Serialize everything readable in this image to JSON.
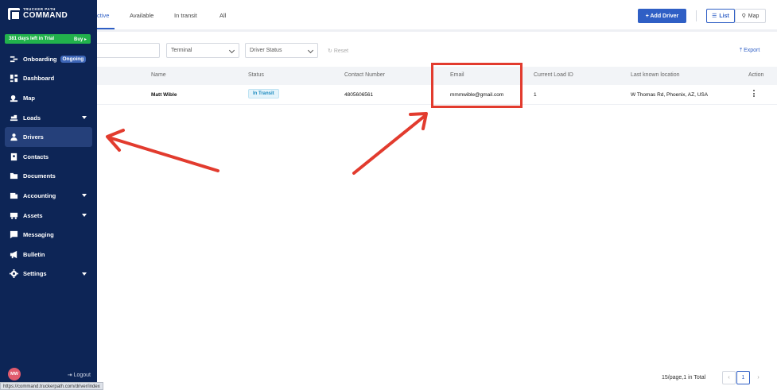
{
  "app": {
    "logo_small": "TRUCKER PATH",
    "logo_big": "COMMAND",
    "trial_text": "381 days left in Trial",
    "trial_buy": "Buy ▸"
  },
  "sidebar": {
    "items": [
      {
        "label": "Onboarding",
        "icon": "onboarding-icon",
        "pill": "Ongoing"
      },
      {
        "label": "Dashboard",
        "icon": "dashboard-icon"
      },
      {
        "label": "Map",
        "icon": "map-icon"
      },
      {
        "label": "Loads",
        "icon": "loads-icon",
        "caret": true
      },
      {
        "label": "Drivers",
        "icon": "driver-icon",
        "active": true
      },
      {
        "label": "Contacts",
        "icon": "contacts-icon"
      },
      {
        "label": "Documents",
        "icon": "folder-icon"
      },
      {
        "label": "Accounting",
        "icon": "accounting-icon",
        "caret": true
      },
      {
        "label": "Assets",
        "icon": "truck-icon",
        "caret": true
      },
      {
        "label": "Messaging",
        "icon": "message-icon"
      },
      {
        "label": "Bulletin",
        "icon": "megaphone-icon"
      },
      {
        "label": "Settings",
        "icon": "gear-icon",
        "caret": true
      }
    ],
    "avatar_initials": "MW",
    "logout_label": "⇥ Logout",
    "status_url": "https://command.truckerpath.com/driver/index"
  },
  "tabs": [
    "ctive",
    "Available",
    "In transit",
    "All"
  ],
  "toolbar": {
    "add_driver": "+ Add Driver",
    "list": "List",
    "map": "Map"
  },
  "filters": {
    "terminal": "Terminal",
    "driver_status": "Driver Status",
    "reset": "Reset",
    "export": "Export"
  },
  "table": {
    "headers": [
      "Name",
      "Status",
      "Contact Number",
      "Email",
      "Current Load ID",
      "Last known location",
      "Action"
    ],
    "rows": [
      {
        "name": "Matt Wible",
        "status": "In Transit",
        "phone": "4805606561",
        "email": "mmmwible@gmail.com",
        "load_id": "1",
        "location": "W Thomas Rd, Phoenix, AZ, USA"
      }
    ]
  },
  "pagination": {
    "summary": "15/page,1 in Total",
    "prev": "‹",
    "page": "1",
    "next": "›"
  },
  "colors": {
    "sidebar": "#0d2556",
    "primary": "#2f5fc5",
    "trial": "#22b24c",
    "annotation": "#e23b2e"
  }
}
